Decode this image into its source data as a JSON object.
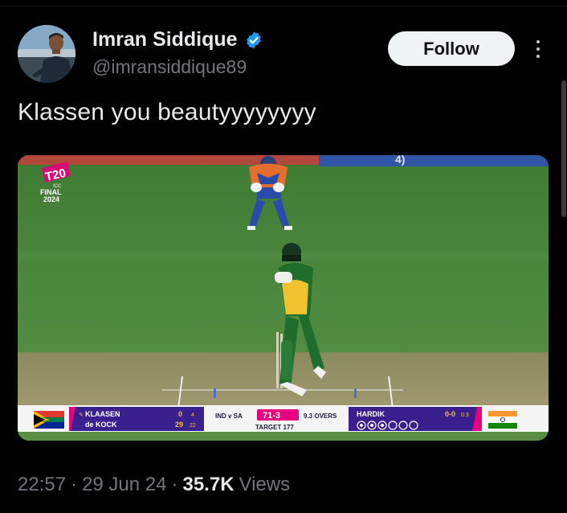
{
  "author": {
    "display_name": "Imran Siddique",
    "handle": "@imransiddique89",
    "verified": true,
    "verified_color": "#1d9bf0"
  },
  "actions": {
    "follow_label": "Follow"
  },
  "tweet": {
    "text": "Klassen you beautyyyyyyyy"
  },
  "media": {
    "event_logo": {
      "brand": "T20",
      "event": "FINAL",
      "year": "2024"
    },
    "scorecard": {
      "batter_1": "KLAASEN",
      "batter_1_runs": "0",
      "batter_1_balls": "4",
      "batter_2": "de KOCK",
      "batter_2_runs": "29",
      "batter_2_balls": "22",
      "match": "IND v SA",
      "score": "71-3",
      "overs": "9.3 OVERS",
      "target": "TARGET 177",
      "bowler": "HARDIK",
      "bowler_figures": "0-0",
      "bowler_overs": "0.3"
    }
  },
  "meta": {
    "time": "22:57",
    "date": "29 Jun 24",
    "views_count": "35.7K",
    "views_label": "Views"
  }
}
